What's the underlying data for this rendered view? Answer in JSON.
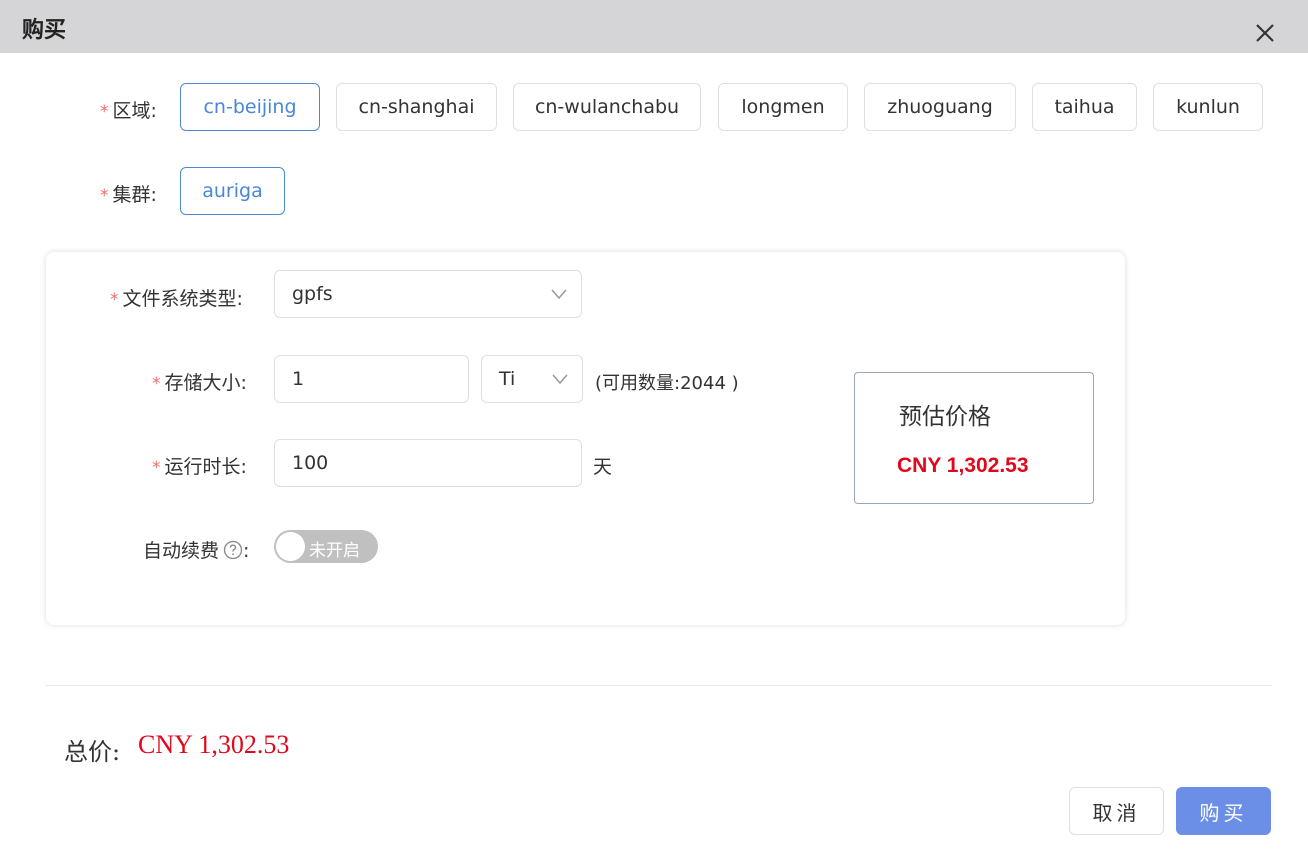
{
  "dialog": {
    "title": "购买",
    "close_icon": "close-icon"
  },
  "form": {
    "region": {
      "label": "区域:",
      "required_mark": "*",
      "options": [
        "cn-beijing",
        "cn-shanghai",
        "cn-wulanchabu",
        "longmen",
        "zhuoguang",
        "taihua",
        "kunlun"
      ],
      "selected": "cn-beijing"
    },
    "cluster": {
      "label": "集群:",
      "required_mark": "*",
      "options": [
        "auriga"
      ],
      "selected": "auriga"
    },
    "fs_type": {
      "label": "文件系统类型:",
      "required_mark": "*",
      "value": "gpfs"
    },
    "storage_size": {
      "label": "存储大小:",
      "required_mark": "*",
      "value": "1",
      "unit": "Ti",
      "available_text": "(可用数量:2044 )"
    },
    "duration": {
      "label": "运行时长:",
      "required_mark": "*",
      "value": "100",
      "unit": "天"
    },
    "auto_renew": {
      "label": "自动续费",
      "colon": ":",
      "toggle_text": "未开启",
      "enabled": false,
      "help_icon": "question-circle-icon"
    }
  },
  "estimate": {
    "label": "预估价格",
    "value": "CNY 1,302.53"
  },
  "footer": {
    "total_label": "总价:",
    "total_value": "CNY 1,302.53",
    "cancel_label": "取消",
    "buy_label": "购买"
  },
  "colors": {
    "accent": "#4a86d8",
    "price_red": "#e0081c",
    "primary_button": "#6b8fe6",
    "header_bg": "#d5d5d7"
  }
}
